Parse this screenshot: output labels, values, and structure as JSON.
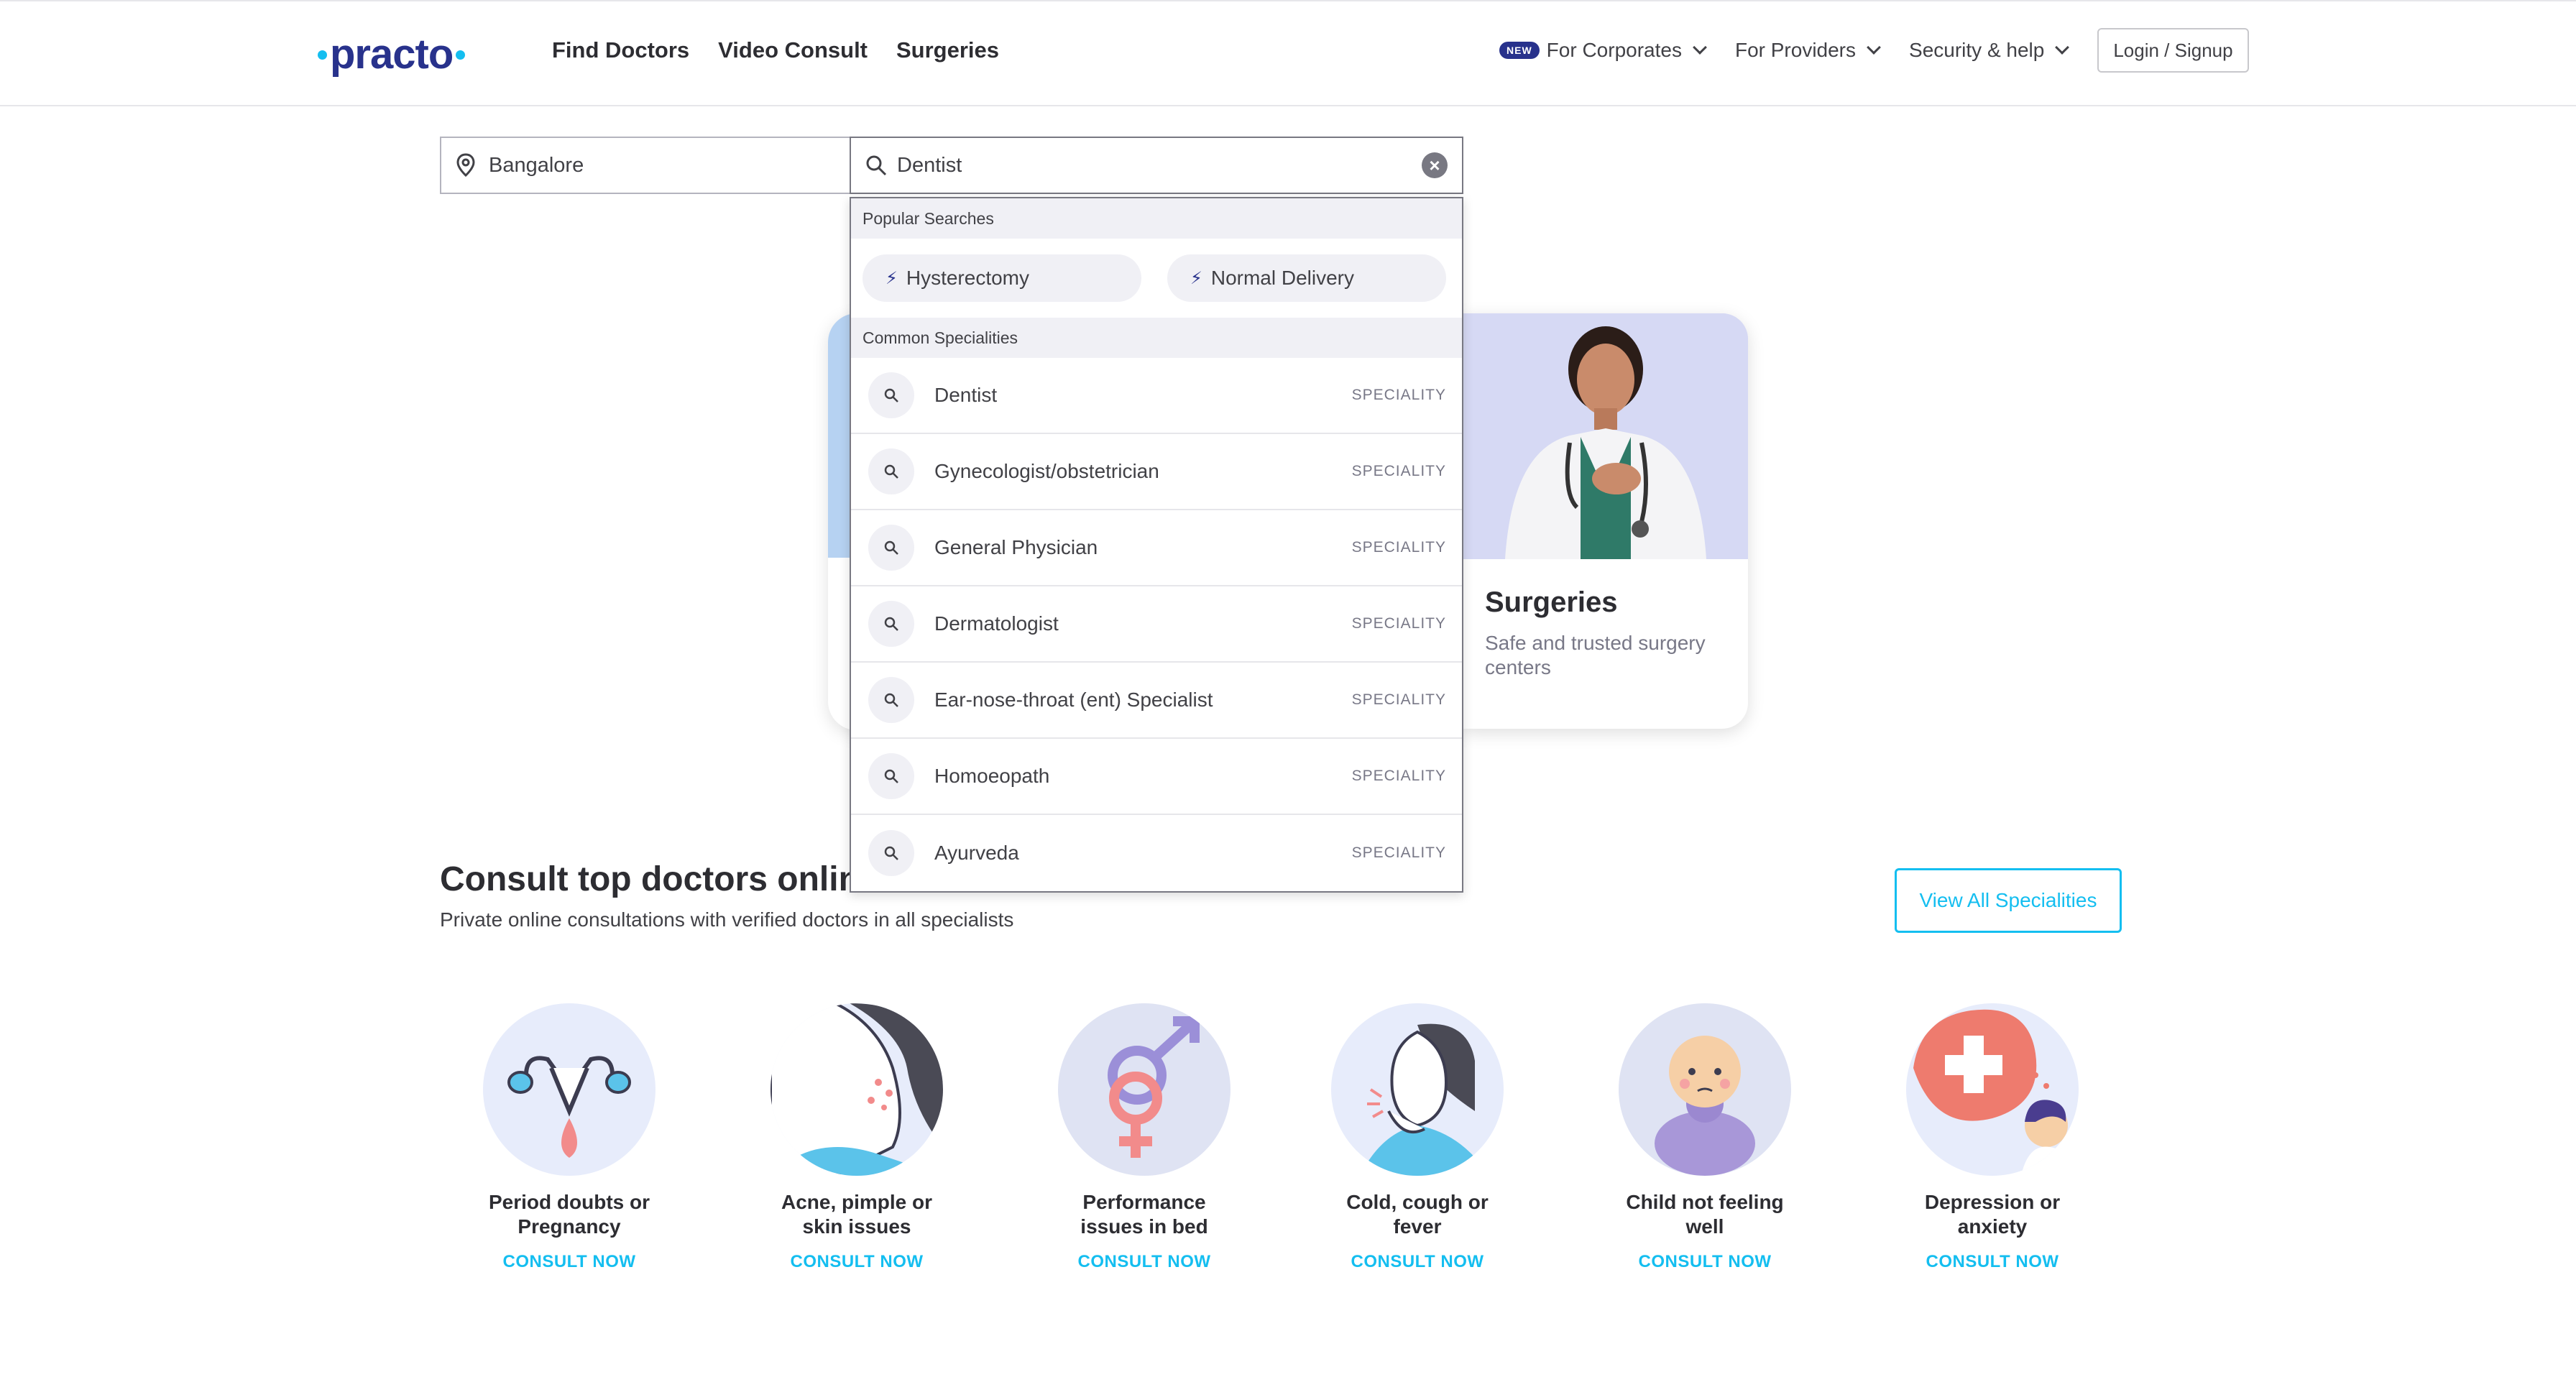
{
  "header": {
    "logo": "practo",
    "nav": [
      "Find Doctors",
      "Video Consult",
      "Surgeries"
    ],
    "new_badge": "NEW",
    "corporates": "For Corporates",
    "providers": "For Providers",
    "security": "Security & help",
    "login": "Login / Signup"
  },
  "search": {
    "location": "Bangalore",
    "query": "Dentist"
  },
  "dropdown": {
    "popular_heading": "Popular Searches",
    "popular": [
      "Hysterectomy",
      "Normal Delivery"
    ],
    "common_heading": "Common Specialities",
    "specialities": [
      {
        "name": "Dentist",
        "tag": "SPECIALITY"
      },
      {
        "name": "Gynecologist/obstetrician",
        "tag": "SPECIALITY"
      },
      {
        "name": "General Physician",
        "tag": "SPECIALITY"
      },
      {
        "name": "Dermatologist",
        "tag": "SPECIALITY"
      },
      {
        "name": "Ear-nose-throat (ent) Specialist",
        "tag": "SPECIALITY"
      },
      {
        "name": "Homoeopath",
        "tag": "SPECIALITY"
      },
      {
        "name": "Ayurveda",
        "tag": "SPECIALITY"
      }
    ]
  },
  "surgeries_card": {
    "title": "Surgeries",
    "subtitle": "Safe and trusted surgery centers"
  },
  "consult": {
    "title_visible": "Consult top doctors online",
    "subtitle": "Private online consultations with verified doctors in all specialists",
    "view_all": "View All Specialities",
    "cta": "CONSULT NOW",
    "items": [
      {
        "line1": "Period doubts or",
        "line2": "Pregnancy",
        "icon": "uterus-icon"
      },
      {
        "line1": "Acne, pimple or",
        "line2": "skin issues",
        "icon": "acne-face-icon"
      },
      {
        "line1": "Performance",
        "line2": "issues in bed",
        "icon": "gender-symbols-icon"
      },
      {
        "line1": "Cold, cough or",
        "line2": "fever",
        "icon": "coughing-man-icon"
      },
      {
        "line1": "Child not feeling",
        "line2": "well",
        "icon": "baby-icon"
      },
      {
        "line1": "Depression or",
        "line2": "anxiety",
        "icon": "mental-health-icon"
      }
    ]
  },
  "colors": {
    "brand": "#28328c",
    "accent": "#14bef0"
  }
}
